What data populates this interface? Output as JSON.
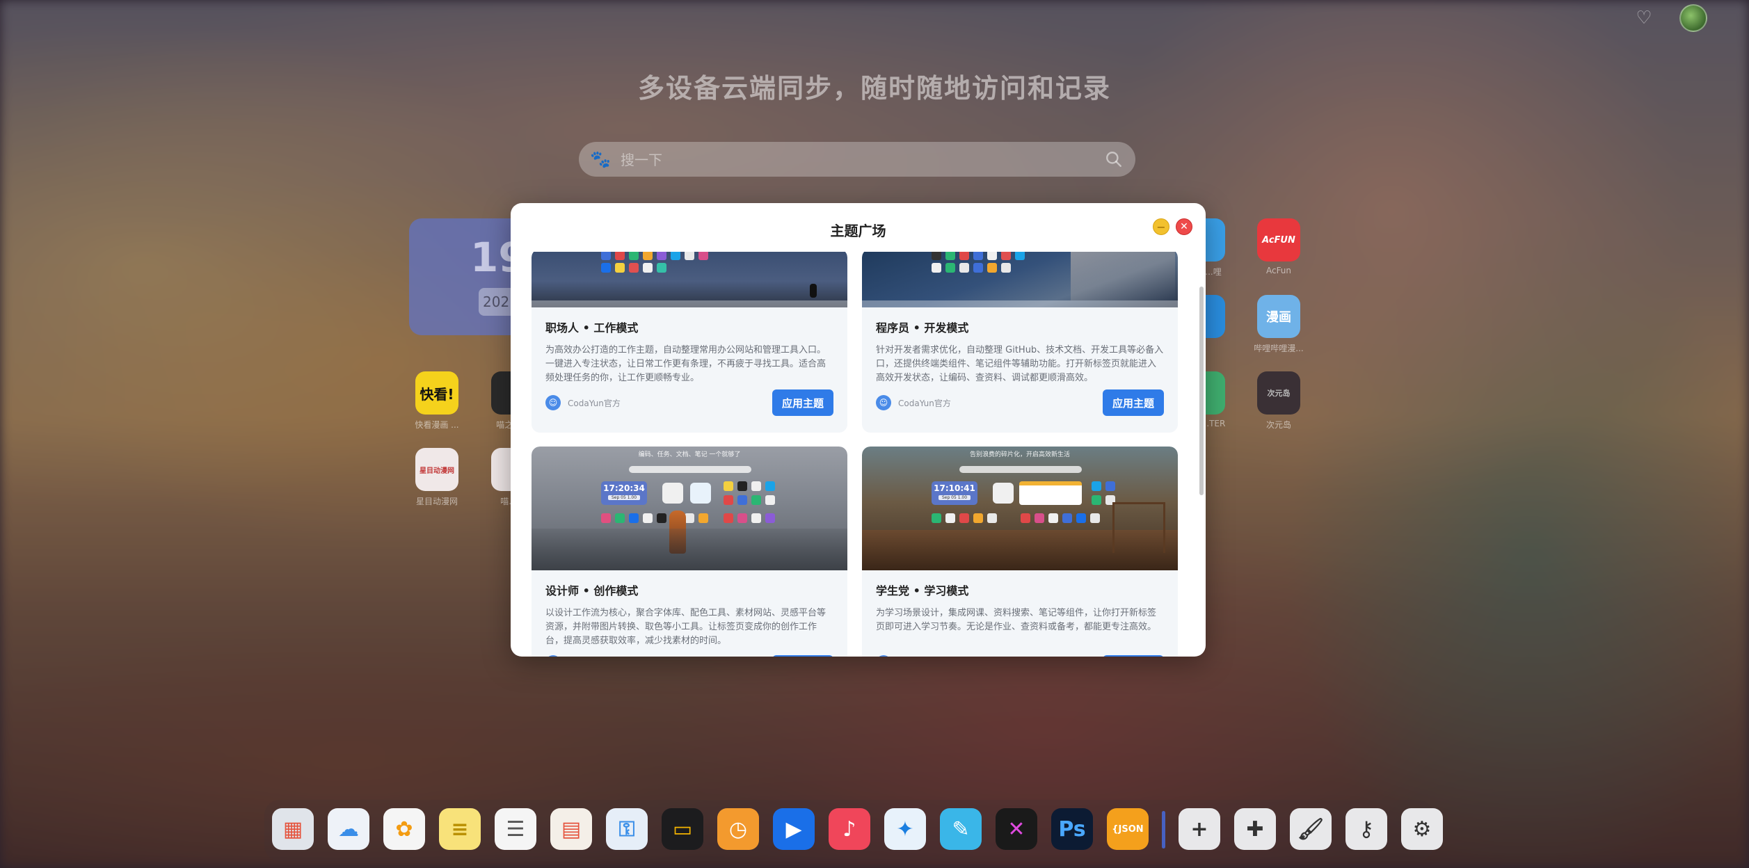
{
  "background": {
    "headline": "多设备云端同步，随时随地访问和记录",
    "search": {
      "placeholder": "搜一下",
      "engine_icon": "baidu-paw-icon"
    },
    "clock": {
      "time": "19",
      "date": "202"
    },
    "apps": [
      {
        "label": "快看漫画 ...",
        "icon_text": "快看!",
        "color": "#f5d21c",
        "text_color": "#111"
      },
      {
        "label": "喵之...",
        "icon_text": "",
        "color": "#2a2a2a",
        "text_color": "#fff"
      },
      {
        "label": "星目动漫网",
        "icon_text": "星目动漫网",
        "color": "#f0e8e8",
        "text_color": "#c23a3a"
      },
      {
        "label": "喵...",
        "icon_text": "",
        "color": "#f0e8e8",
        "text_color": "#c23a3a"
      },
      {
        "label": "AcFun",
        "icon_text": "AcFUN",
        "color": "#e8383d",
        "text_color": "#fff"
      },
      {
        "label": "哔哩哔哩漫...",
        "icon_text": "漫画",
        "color": "#6fb2e8",
        "text_color": "#fff"
      },
      {
        "label": "次元岛",
        "icon_text": "次元岛",
        "color": "#3a3035",
        "text_color": "#bbb"
      },
      {
        "label": "...哩",
        "icon_text": "",
        "color": "#3aa0e8",
        "text_color": "#fff"
      },
      {
        "label": "...",
        "icon_text": "",
        "color": "#2a8ee0",
        "text_color": "#fff"
      },
      {
        "label": "...TER",
        "icon_text": "",
        "color": "#40b070",
        "text_color": "#fff"
      }
    ],
    "dock": [
      {
        "name": "launchpad-icon",
        "color": "#e0e4ea",
        "glyph": "▦",
        "glyph_color": "#e5533d"
      },
      {
        "name": "icloud-icon",
        "color": "#eef2f8",
        "glyph": "☁",
        "glyph_color": "#3a8ee8"
      },
      {
        "name": "photos-icon",
        "color": "#f5f5f5",
        "glyph": "✿",
        "glyph_color": "#f39c12"
      },
      {
        "name": "notes-icon",
        "color": "#f8e27a",
        "glyph": "≡",
        "glyph_color": "#b98f00"
      },
      {
        "name": "reminders-icon",
        "color": "#f5f5f5",
        "glyph": "☰",
        "glyph_color": "#555"
      },
      {
        "name": "calendar-icon",
        "color": "#f4efe8",
        "glyph": "▤",
        "glyph_color": "#e5533d"
      },
      {
        "name": "passwords-icon",
        "color": "#e6eef8",
        "glyph": "⚿",
        "glyph_color": "#3a8ee8"
      },
      {
        "name": "wallet-icon",
        "color": "#1c1c1e",
        "glyph": "▭",
        "glyph_color": "#f4b400"
      },
      {
        "name": "clock-app-icon",
        "color": "#f39a2e",
        "glyph": "◷",
        "glyph_color": "#fff"
      },
      {
        "name": "play-icon",
        "color": "#1a6fe8",
        "glyph": "▶",
        "glyph_color": "#fff"
      },
      {
        "name": "music-icon",
        "color": "#f0465a",
        "glyph": "♪",
        "glyph_color": "#fff"
      },
      {
        "name": "safari-icon",
        "color": "#e8f2fb",
        "glyph": "✦",
        "glyph_color": "#1a7ee0"
      },
      {
        "name": "freeform-icon",
        "color": "#3ab6e8",
        "glyph": "✎",
        "glyph_color": "#fff"
      },
      {
        "name": "devtools-icon",
        "color": "#1a1a1a",
        "glyph": "✕",
        "glyph_color": "#e04ae0"
      },
      {
        "name": "photoshop-icon",
        "color": "#0c1b33",
        "glyph": "Ps",
        "glyph_color": "#4aa8ff"
      },
      {
        "name": "json-icon",
        "color": "#f4a01c",
        "glyph": "{JSON",
        "glyph_color": "#fff"
      },
      {
        "name": "add-icon",
        "color": "#e8e8ea",
        "glyph": "+",
        "glyph_color": "#333"
      },
      {
        "name": "plugins-icon",
        "color": "#e8e8ea",
        "glyph": "✚",
        "glyph_color": "#333"
      },
      {
        "name": "brush-icon",
        "color": "#e8e8ea",
        "glyph": "🖌",
        "glyph_color": "#333"
      },
      {
        "name": "lock-icon",
        "color": "#e8e8ea",
        "glyph": "⚷",
        "glyph_color": "#333"
      },
      {
        "name": "settings-icon",
        "color": "#e8e8ea",
        "glyph": "⚙",
        "glyph_color": "#333"
      }
    ]
  },
  "modal": {
    "title": "主题广场",
    "themes": [
      {
        "name": "职场人 • 工作模式",
        "description": "为高效办公打造的工作主题，自动整理常用办公网站和管理工具入口。一键进入专注状态，让日常工作更有条理，不再疲于寻找工具。适合高频处理任务的你，让工作更顺畅专业。",
        "author": "CodaYun官方",
        "button": "应用主题"
      },
      {
        "name": "程序员 • 开发模式",
        "description": "针对开发者需求优化，自动整理 GitHub、技术文档、开发工具等必备入口，还提供终端类组件、笔记组件等辅助功能。打开新标签页就能进入高效开发状态，让编码、查资料、调试都更顺滑高效。",
        "author": "CodaYun官方",
        "button": "应用主题"
      },
      {
        "name": "设计师 • 创作模式",
        "description": "以设计工作流为核心，聚合字体库、配色工具、素材网站、灵感平台等资源，并附带图片转换、取色等小工具。让标签页变成你的创作工作台，提高灵感获取效率，减少找素材的时间。",
        "preview_caption": "编码、任务、文档、笔记 一个就够了",
        "preview_time": "17:20:34",
        "preview_date": "Sep 05 1.00"
      },
      {
        "name": "学生党 • 学习模式",
        "description": "为学习场景设计，集成网课、资料搜索、笔记等组件，让你打开新标签页即可进入学习节奏。无论是作业、查资料或备考，都能更专注高效。",
        "preview_caption": "告别浪费的碎片化，开启高效新生活",
        "preview_time": "17:10:41",
        "preview_date": "Sep 05 1.00"
      }
    ]
  }
}
